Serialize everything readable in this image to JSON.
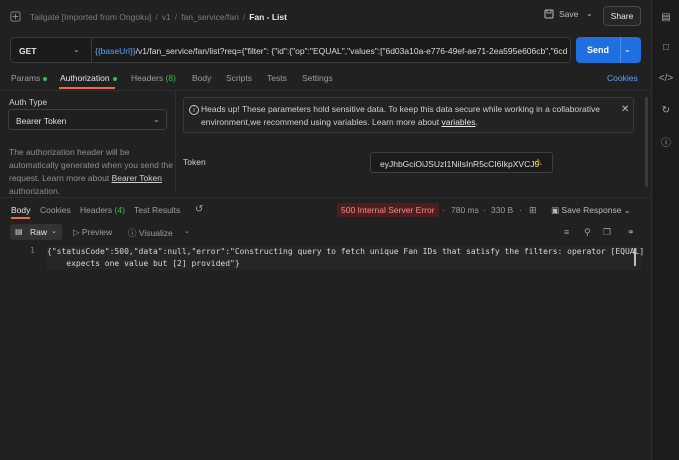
{
  "header": {
    "breadcrumbs": [
      "Tailgate [Imported from Ongoku]",
      "v1",
      "fan_service/fan"
    ],
    "current": "Fan - List",
    "save_label": "Save",
    "share_label": "Share"
  },
  "request": {
    "method": "GET",
    "url_var": "{{baseUrl}}",
    "url_rest": "/v1/fan_service/fan/list?req={\"filter\": {\"id\":{\"op\":\"EQUAL\",\"values\":[\"6d03a10a-e776-49ef-ae71-2ea595e606cb\",\"6cde...",
    "send_label": "Send"
  },
  "req_tabs": {
    "params": "Params",
    "authorization": "Authorization",
    "headers": "Headers",
    "headers_count": "(8)",
    "body": "Body",
    "scripts": "Scripts",
    "tests": "Tests",
    "settings": "Settings",
    "cookies": "Cookies"
  },
  "auth": {
    "type_label": "Auth Type",
    "type_value": "Bearer Token",
    "help_text": "The authorization header will be automatically generated when you send the request. Learn more about",
    "help_link": "Bearer Token",
    "help_suffix": "authorization.",
    "alert_text": "Heads up! These parameters hold sensitive data. To keep this data secure while working in a collaborative environment,we recommend using variables. Learn more about",
    "alert_link": "variables",
    "alert_suffix": ".",
    "token_label": "Token",
    "token_value": "eyJhbGciOiJSUzI1NiIsInR5cCI6IkpXVCJ9"
  },
  "response": {
    "body_tab": "Body",
    "cookies_tab": "Cookies",
    "headers_tab": "Headers",
    "headers_count": "(4)",
    "results_tab": "Test Results",
    "status": "500 Internal Server Error",
    "time": "780 ms",
    "size": "330 B",
    "save_response": "Save Response",
    "format": "Raw",
    "preview": "Preview",
    "visualize": "Visualize",
    "line_number": "1",
    "line1": "{\"statusCode\":500,\"data\":null,\"error\":\"Constructing query to fetch unique Fan IDs that satisfy the filters: operator [EQUAL]",
    "line2": "    expects one value but [2] provided\"}"
  },
  "colors": {
    "accent": "#f26b3a",
    "send": "#1f6fe0",
    "link": "#5aa6ff",
    "error": "#ff8a8a",
    "ok_dot": "#3fb950"
  }
}
